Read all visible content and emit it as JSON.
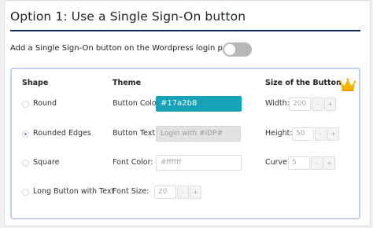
{
  "header": {
    "title": "Option 1: Use a Single Sign-On button",
    "toggle_label": "Add a Single Sign-On button on the Wordpress login page",
    "toggle_on": false
  },
  "table": {
    "columns": {
      "shape": "Shape",
      "theme": "Theme",
      "size": "Size of the Button"
    },
    "shapes": [
      {
        "label": "Round",
        "checked": false
      },
      {
        "label": "Rounded Edges",
        "checked": true
      },
      {
        "label": "Square",
        "checked": false
      },
      {
        "label": "Long Button with Text",
        "checked": false
      }
    ],
    "theme": {
      "button_color_label": "Button Color:",
      "button_color_value": "#17a2b8",
      "button_text_label": "Button Text:",
      "button_text_placeholder": "Login with #IDP#",
      "font_color_label": "Font Color:",
      "font_color_placeholder": "#ffffff",
      "font_size_label": "Font Size:",
      "font_size_value": "20"
    },
    "size": {
      "width_label": "Width:",
      "width_value": "200",
      "height_label": "Height:",
      "height_value": "50",
      "curve_label": "Curve:",
      "curve_value": "5"
    },
    "stepper": {
      "minus": "-",
      "plus": "+"
    }
  },
  "colors": {
    "accent": "#17a2b8",
    "title_rule": "#0d2a57",
    "panel_border": "#c3d0ea",
    "crown": "#f5b400"
  },
  "icons": {
    "premium": "crown-icon"
  }
}
